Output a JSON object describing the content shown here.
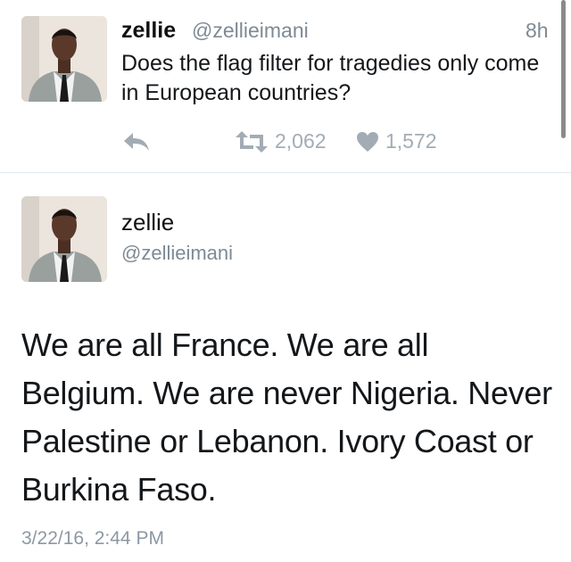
{
  "tweet_1": {
    "display_name": "zellie",
    "handle": "@zellieimani",
    "time_ago": "8h",
    "text": "Does the flag filter for tragedies only come in European countries?",
    "retweets": "2,062",
    "likes": "1,572",
    "icons": [
      "reply-icon",
      "retweet-icon",
      "like-icon"
    ]
  },
  "tweet_2": {
    "display_name": "zellie",
    "handle": "@zellieimani",
    "text": "We are all France. We are all Belgium. We are never Nigeria. Never Palestine or Lebanon. Ivory Coast or Burkina Faso.",
    "timestamp": "3/22/16, 2:44 PM"
  },
  "colors": {
    "text": "#14171a",
    "secondary": "#7d8a95",
    "action_icons": "#a3acb4",
    "divider": "#e1e8ed"
  }
}
